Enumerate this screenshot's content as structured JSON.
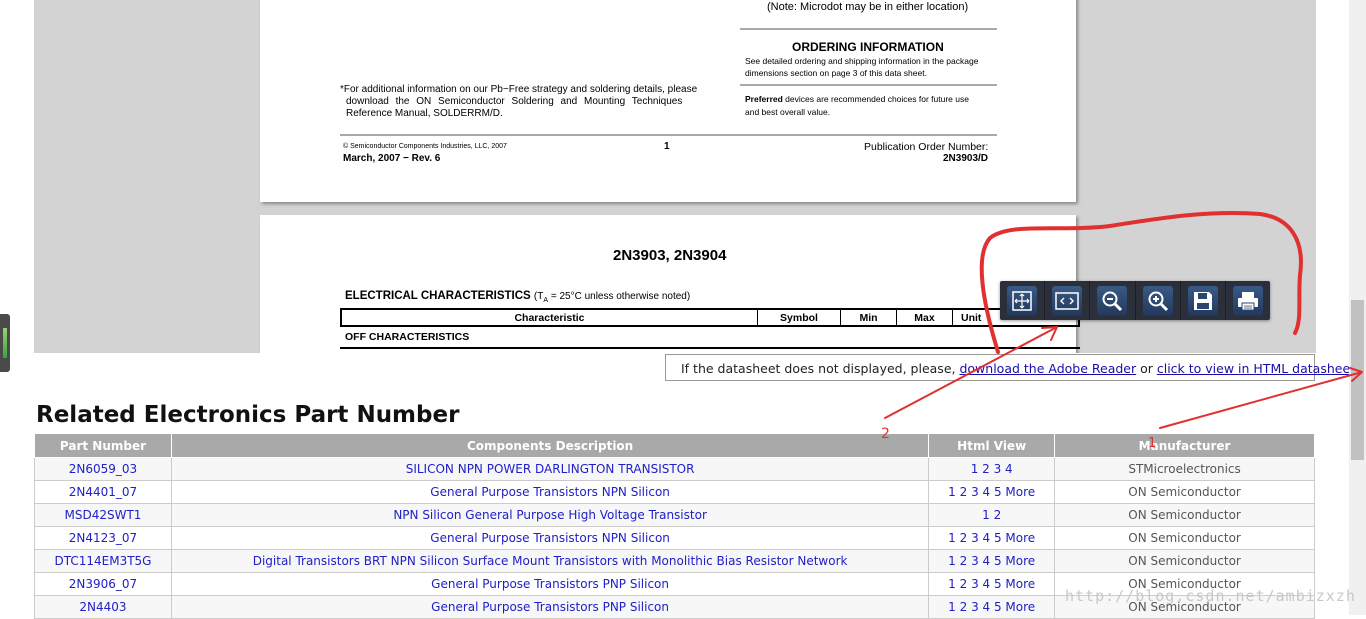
{
  "pdf": {
    "page1": {
      "microdot_note": "(Note: Microdot may be in either location)",
      "ordering_title": "ORDERING INFORMATION",
      "ordering_line1": "See detailed ordering and shipping information in the package",
      "ordering_line2": "dimensions section on page 3 of this data sheet.",
      "preferred_bold": "Preferred",
      "preferred_line1": " devices are recommended choices for future use",
      "preferred_line2": "and best overall value.",
      "pbfree_line1": "*For additional information on our Pb−Free strategy and soldering details, please",
      "pbfree_line2": "download the ON Semiconductor Soldering and Mounting Techniques",
      "pbfree_line3": "Reference Manual, SOLDERRM/D.",
      "copyright": "©  Semiconductor Components Industries, LLC, 2007",
      "page_number": "1",
      "pub_label": "Publication Order Number:",
      "date_rev": "March, 2007 − Rev. 6",
      "pub_number": "2N3903/D"
    },
    "page2": {
      "title": "2N3903, 2N3904",
      "elec_title": "ELECTRICAL CHARACTERISTICS",
      "elec_cond_pre": "(T",
      "elec_cond_sub": "A",
      "elec_cond_post": " = 25°C unless otherwise noted)",
      "columns": [
        "Characteristic",
        "Symbol",
        "Min",
        "Max",
        "Unit"
      ],
      "section": "OFF CHARACTERISTICS"
    }
  },
  "toolbar": {
    "buttons": [
      {
        "icon": "fit-page-icon"
      },
      {
        "icon": "fit-width-icon"
      },
      {
        "icon": "zoom-out-icon"
      },
      {
        "icon": "zoom-in-icon"
      },
      {
        "icon": "save-icon"
      },
      {
        "icon": "print-icon"
      }
    ]
  },
  "notice": {
    "prefix": "If the datasheet does not displayed, please, ",
    "link1": "download the Adobe Reader",
    "mid": " or ",
    "link2": "click to view in HTML datasheet."
  },
  "related": {
    "title": "Related Electronics Part Number",
    "headers": [
      "Part Number",
      "Components Description",
      "Html View",
      "Manufacturer"
    ],
    "rows": [
      {
        "part": "2N6059_03",
        "desc": "SILICON NPN POWER DARLINGTON TRANSISTOR",
        "html": "1 2 3 4",
        "mfr": "STMicroelectronics"
      },
      {
        "part": "2N4401_07",
        "desc": "General Purpose Transistors NPN Silicon",
        "html": "1 2 3 4 5 More",
        "mfr": "ON Semiconductor"
      },
      {
        "part": "MSD42SWT1",
        "desc": "NPN Silicon General Purpose High Voltage Transistor",
        "html": "1 2",
        "mfr": "ON Semiconductor"
      },
      {
        "part": "2N4123_07",
        "desc": "General Purpose Transistors NPN Silicon",
        "html": "1 2 3 4 5 More",
        "mfr": "ON Semiconductor"
      },
      {
        "part": "DTC114EM3T5G",
        "desc": "Digital Transistors BRT NPN Silicon Surface Mount Transistors with Monolithic Bias Resistor Network",
        "html": "1 2 3 4 5 More",
        "mfr": "ON Semiconductor"
      },
      {
        "part": "2N3906_07",
        "desc": "General Purpose Transistors PNP Silicon",
        "html": "1 2 3 4 5 More",
        "mfr": "ON Semiconductor"
      },
      {
        "part": "2N4403",
        "desc": "General Purpose Transistors PNP Silicon",
        "html": "1 2 3 4 5 More",
        "mfr": "ON Semiconductor"
      }
    ]
  },
  "annotations": {
    "mark2": "2",
    "mark1": "1",
    "color": "#e03030"
  },
  "watermark": "http://blog.csdn.net/ambizxzh"
}
